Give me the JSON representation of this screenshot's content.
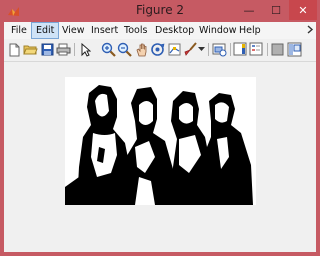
{
  "window": {
    "title": "Figure 2",
    "controls": {
      "minimize": "—",
      "maximize": "☐",
      "close": "✕"
    }
  },
  "menubar": {
    "items": [
      "File",
      "Edit",
      "View",
      "Insert",
      "Tools",
      "Desktop",
      "Window",
      "Help"
    ],
    "active": "Edit",
    "overflow_icon": "chevron-right-icon"
  },
  "toolbar": {
    "icons": [
      "new-figure-icon",
      "open-file-icon",
      "save-icon",
      "print-icon",
      "pointer-icon",
      "zoom-in-icon",
      "zoom-out-icon",
      "pan-icon",
      "rotate-3d-icon",
      "data-cursor-icon",
      "brush-icon",
      "link-plot-icon",
      "colorbar-icon",
      "legend-icon",
      "hide-plot-tools-icon",
      "show-plot-tools-icon"
    ]
  },
  "figure": {
    "image_description": "black and white thresholded photo of four people",
    "colors": {
      "foreground": "#000000",
      "background": "#ffffff"
    }
  }
}
